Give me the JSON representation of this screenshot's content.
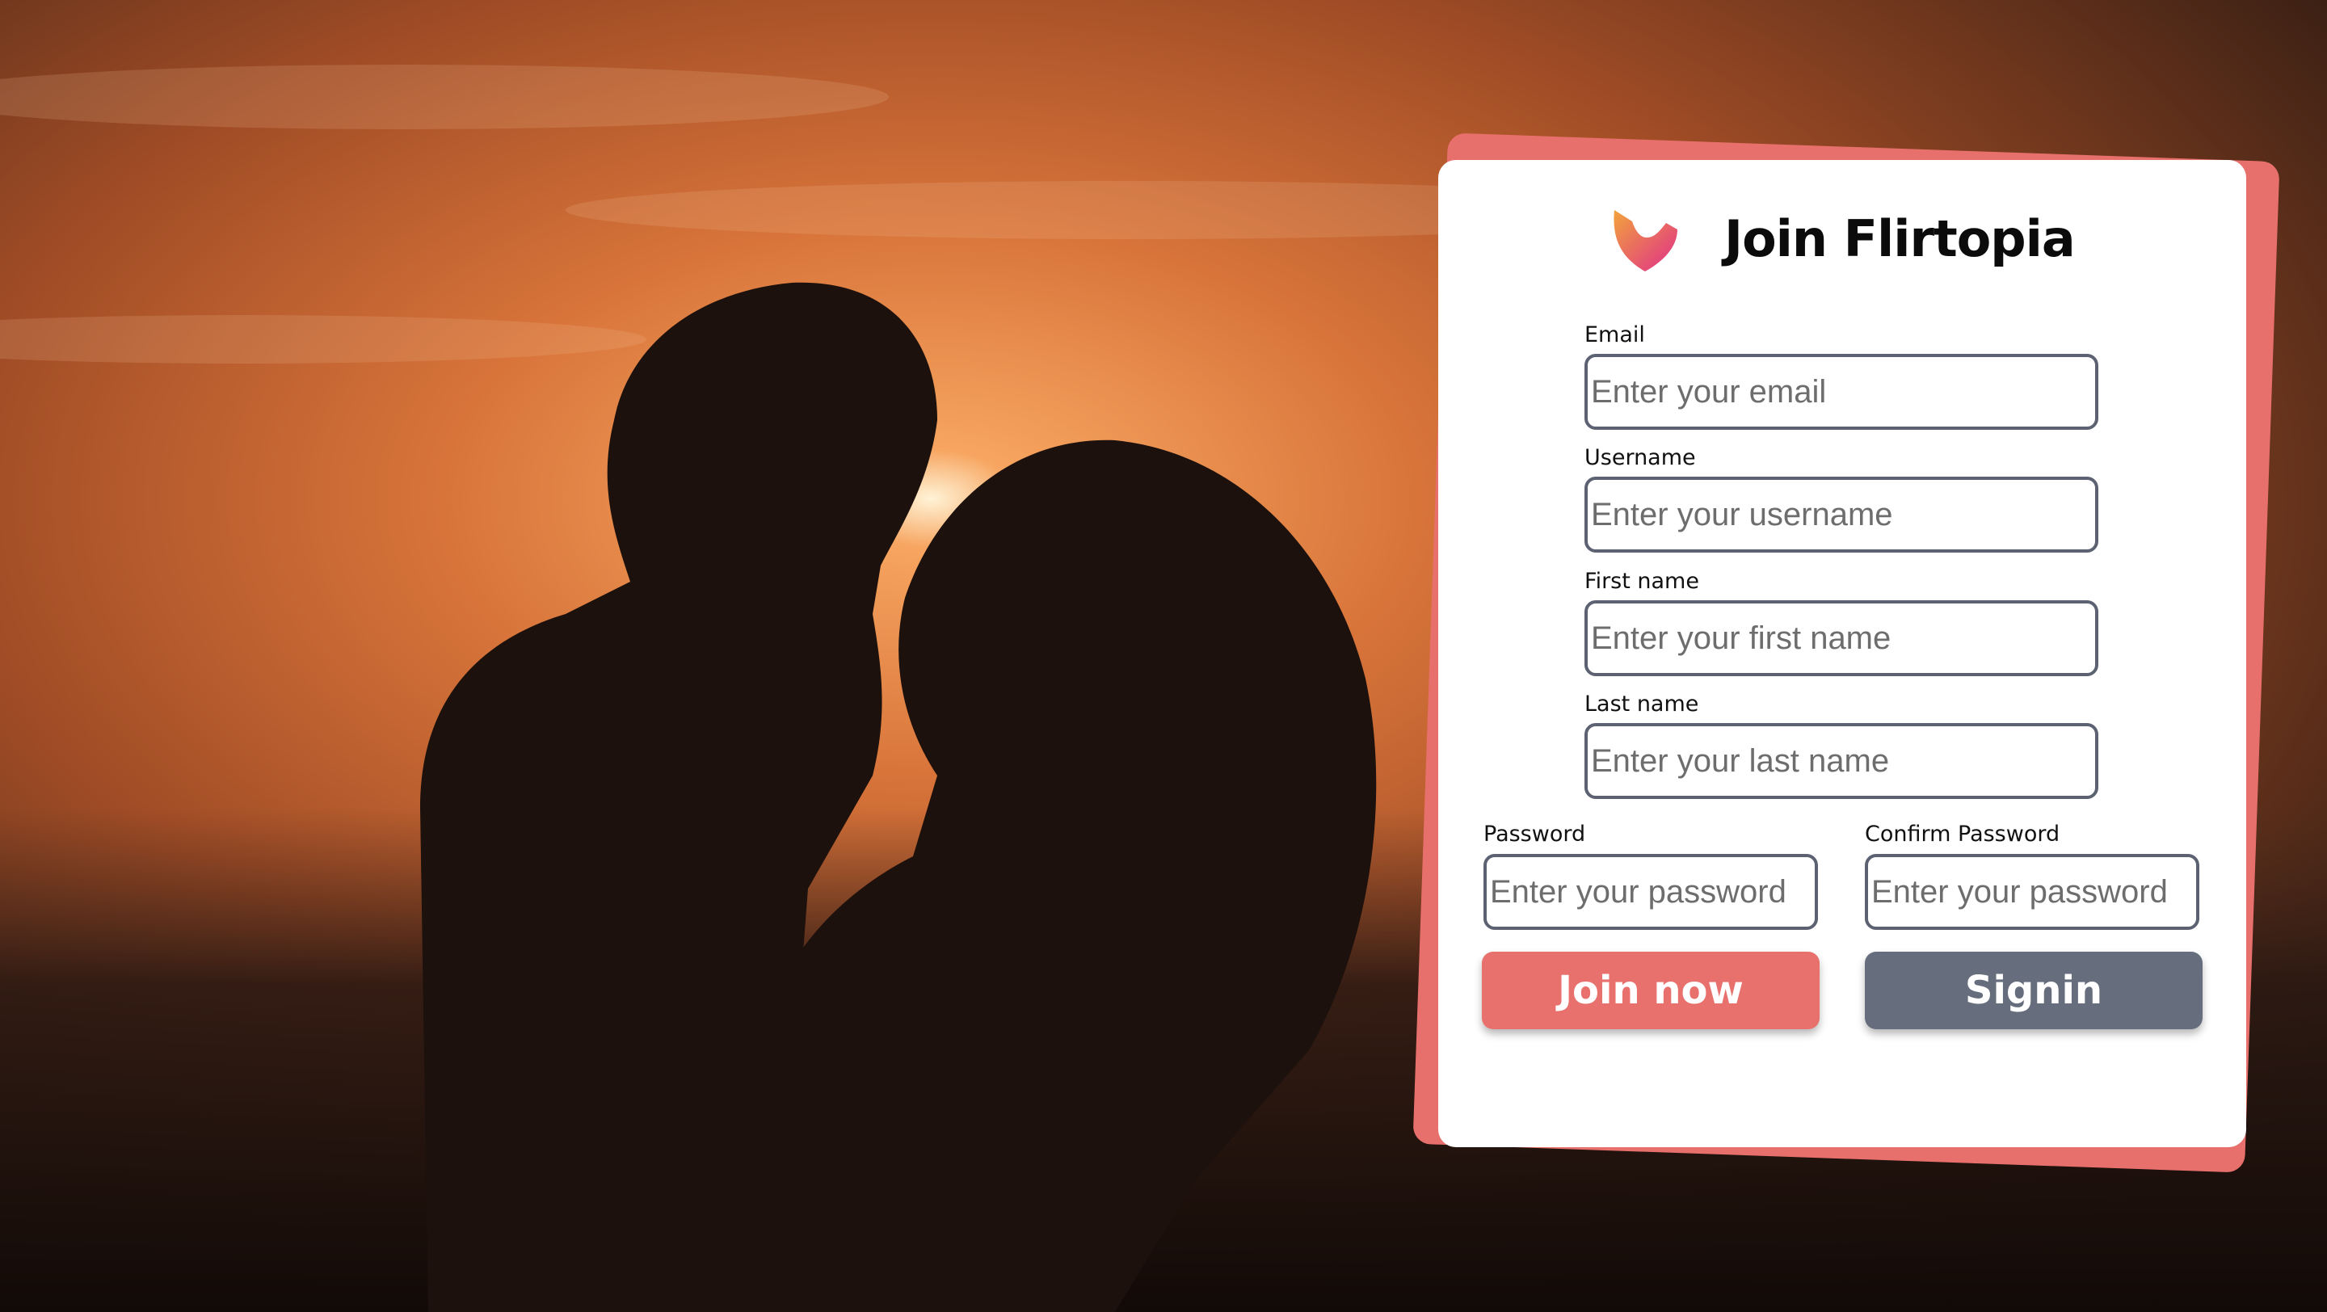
{
  "app": {
    "title": "Join Flirtopia",
    "logo_icon": "heart-check-logo-icon",
    "background_image": "couple-sunset-silhouette"
  },
  "form": {
    "email": {
      "label": "Email",
      "placeholder": "Enter your email",
      "value": ""
    },
    "username": {
      "label": "Username",
      "placeholder": "Enter your username",
      "value": ""
    },
    "first_name": {
      "label": "First name",
      "placeholder": "Enter your first name",
      "value": ""
    },
    "last_name": {
      "label": "Last name",
      "placeholder": "Enter your last name",
      "value": ""
    },
    "password": {
      "label": "Password",
      "placeholder": "Enter your password",
      "value": ""
    },
    "confirm_password": {
      "label": "Confirm Password",
      "placeholder": "Enter your password",
      "value": ""
    }
  },
  "buttons": {
    "join_label": "Join now",
    "signin_label": "Signin"
  },
  "colors": {
    "accent": "#e8716d",
    "secondary_button": "#666d7d",
    "input_border": "#5c6272",
    "logo_gradient_start": "#f2a33c",
    "logo_gradient_end": "#e02e8a"
  }
}
